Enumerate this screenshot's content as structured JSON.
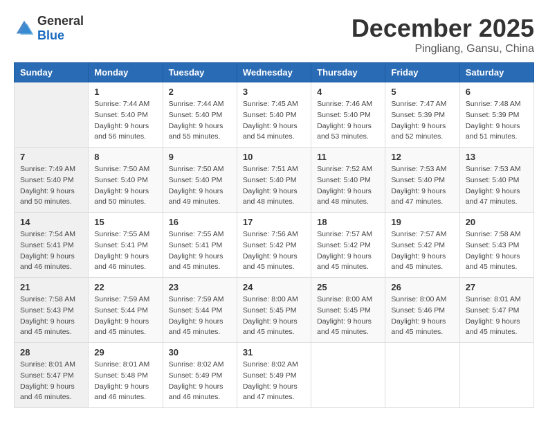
{
  "logo": {
    "general": "General",
    "blue": "Blue"
  },
  "header": {
    "month": "December 2025",
    "location": "Pingliang, Gansu, China"
  },
  "weekdays": [
    "Sunday",
    "Monday",
    "Tuesday",
    "Wednesday",
    "Thursday",
    "Friday",
    "Saturday"
  ],
  "weeks": [
    [
      {
        "day": "",
        "info": ""
      },
      {
        "day": "1",
        "info": "Sunrise: 7:44 AM\nSunset: 5:40 PM\nDaylight: 9 hours\nand 56 minutes."
      },
      {
        "day": "2",
        "info": "Sunrise: 7:44 AM\nSunset: 5:40 PM\nDaylight: 9 hours\nand 55 minutes."
      },
      {
        "day": "3",
        "info": "Sunrise: 7:45 AM\nSunset: 5:40 PM\nDaylight: 9 hours\nand 54 minutes."
      },
      {
        "day": "4",
        "info": "Sunrise: 7:46 AM\nSunset: 5:40 PM\nDaylight: 9 hours\nand 53 minutes."
      },
      {
        "day": "5",
        "info": "Sunrise: 7:47 AM\nSunset: 5:39 PM\nDaylight: 9 hours\nand 52 minutes."
      },
      {
        "day": "6",
        "info": "Sunrise: 7:48 AM\nSunset: 5:39 PM\nDaylight: 9 hours\nand 51 minutes."
      }
    ],
    [
      {
        "day": "7",
        "info": "Sunrise: 7:49 AM\nSunset: 5:40 PM\nDaylight: 9 hours\nand 50 minutes."
      },
      {
        "day": "8",
        "info": "Sunrise: 7:50 AM\nSunset: 5:40 PM\nDaylight: 9 hours\nand 50 minutes."
      },
      {
        "day": "9",
        "info": "Sunrise: 7:50 AM\nSunset: 5:40 PM\nDaylight: 9 hours\nand 49 minutes."
      },
      {
        "day": "10",
        "info": "Sunrise: 7:51 AM\nSunset: 5:40 PM\nDaylight: 9 hours\nand 48 minutes."
      },
      {
        "day": "11",
        "info": "Sunrise: 7:52 AM\nSunset: 5:40 PM\nDaylight: 9 hours\nand 48 minutes."
      },
      {
        "day": "12",
        "info": "Sunrise: 7:53 AM\nSunset: 5:40 PM\nDaylight: 9 hours\nand 47 minutes."
      },
      {
        "day": "13",
        "info": "Sunrise: 7:53 AM\nSunset: 5:40 PM\nDaylight: 9 hours\nand 47 minutes."
      }
    ],
    [
      {
        "day": "14",
        "info": "Sunrise: 7:54 AM\nSunset: 5:41 PM\nDaylight: 9 hours\nand 46 minutes."
      },
      {
        "day": "15",
        "info": "Sunrise: 7:55 AM\nSunset: 5:41 PM\nDaylight: 9 hours\nand 46 minutes."
      },
      {
        "day": "16",
        "info": "Sunrise: 7:55 AM\nSunset: 5:41 PM\nDaylight: 9 hours\nand 45 minutes."
      },
      {
        "day": "17",
        "info": "Sunrise: 7:56 AM\nSunset: 5:42 PM\nDaylight: 9 hours\nand 45 minutes."
      },
      {
        "day": "18",
        "info": "Sunrise: 7:57 AM\nSunset: 5:42 PM\nDaylight: 9 hours\nand 45 minutes."
      },
      {
        "day": "19",
        "info": "Sunrise: 7:57 AM\nSunset: 5:42 PM\nDaylight: 9 hours\nand 45 minutes."
      },
      {
        "day": "20",
        "info": "Sunrise: 7:58 AM\nSunset: 5:43 PM\nDaylight: 9 hours\nand 45 minutes."
      }
    ],
    [
      {
        "day": "21",
        "info": "Sunrise: 7:58 AM\nSunset: 5:43 PM\nDaylight: 9 hours\nand 45 minutes."
      },
      {
        "day": "22",
        "info": "Sunrise: 7:59 AM\nSunset: 5:44 PM\nDaylight: 9 hours\nand 45 minutes."
      },
      {
        "day": "23",
        "info": "Sunrise: 7:59 AM\nSunset: 5:44 PM\nDaylight: 9 hours\nand 45 minutes."
      },
      {
        "day": "24",
        "info": "Sunrise: 8:00 AM\nSunset: 5:45 PM\nDaylight: 9 hours\nand 45 minutes."
      },
      {
        "day": "25",
        "info": "Sunrise: 8:00 AM\nSunset: 5:45 PM\nDaylight: 9 hours\nand 45 minutes."
      },
      {
        "day": "26",
        "info": "Sunrise: 8:00 AM\nSunset: 5:46 PM\nDaylight: 9 hours\nand 45 minutes."
      },
      {
        "day": "27",
        "info": "Sunrise: 8:01 AM\nSunset: 5:47 PM\nDaylight: 9 hours\nand 45 minutes."
      }
    ],
    [
      {
        "day": "28",
        "info": "Sunrise: 8:01 AM\nSunset: 5:47 PM\nDaylight: 9 hours\nand 46 minutes."
      },
      {
        "day": "29",
        "info": "Sunrise: 8:01 AM\nSunset: 5:48 PM\nDaylight: 9 hours\nand 46 minutes."
      },
      {
        "day": "30",
        "info": "Sunrise: 8:02 AM\nSunset: 5:49 PM\nDaylight: 9 hours\nand 46 minutes."
      },
      {
        "day": "31",
        "info": "Sunrise: 8:02 AM\nSunset: 5:49 PM\nDaylight: 9 hours\nand 47 minutes."
      },
      {
        "day": "",
        "info": ""
      },
      {
        "day": "",
        "info": ""
      },
      {
        "day": "",
        "info": ""
      }
    ]
  ]
}
